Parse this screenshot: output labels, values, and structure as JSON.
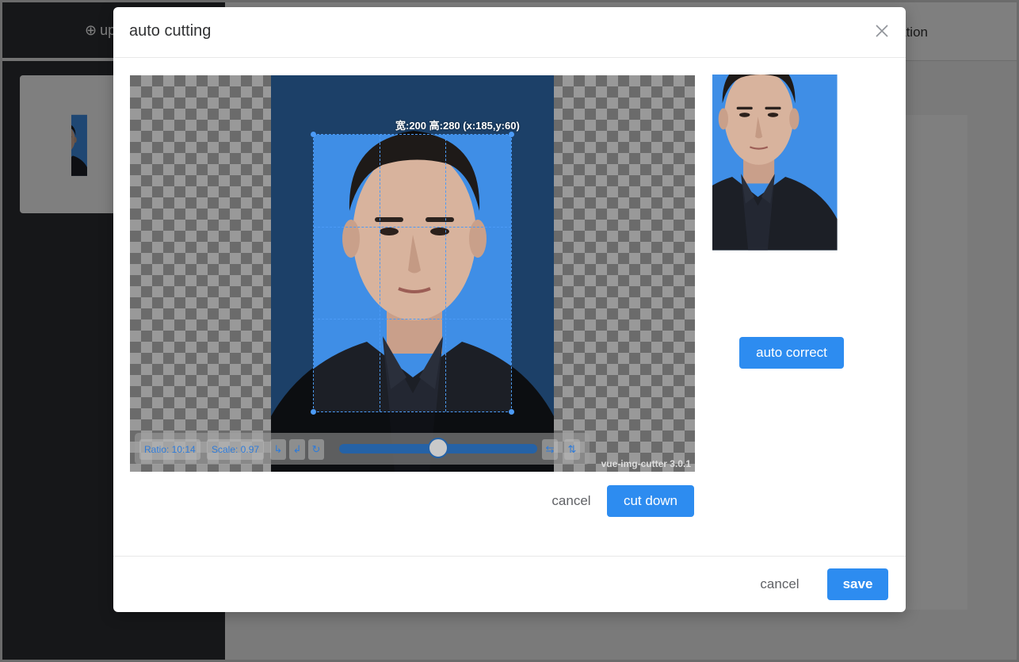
{
  "background_app": {
    "sidebar_tab_label": "up",
    "topbar_nav_label": "ation"
  },
  "modal": {
    "title": "auto cutting",
    "cutter": {
      "size_label": "宽:200 高:280 (x:185,y:60)",
      "ratio_label": "Ratio: 10:14",
      "scale_label": "Scale: 0.97",
      "scale_slider_fraction": 0.5,
      "version_label": "vue-img-cutter 3.0.1",
      "icons": [
        "rotate-left-icon",
        "rotate-right-icon",
        "reset-rotation-icon",
        "flip-horizontal-icon",
        "flip-vertical-icon"
      ]
    },
    "cutter_actions": {
      "cancel_label": "cancel",
      "cut_label": "cut down"
    },
    "preview": {
      "auto_correct_label": "auto correct"
    },
    "footer": {
      "cancel_label": "cancel",
      "save_label": "save"
    }
  },
  "colors": {
    "primary": "#2d8cf0",
    "photo_background": "#3f8ee6",
    "suit": "#1c1f26",
    "crop_line": "#4c9bf7"
  }
}
